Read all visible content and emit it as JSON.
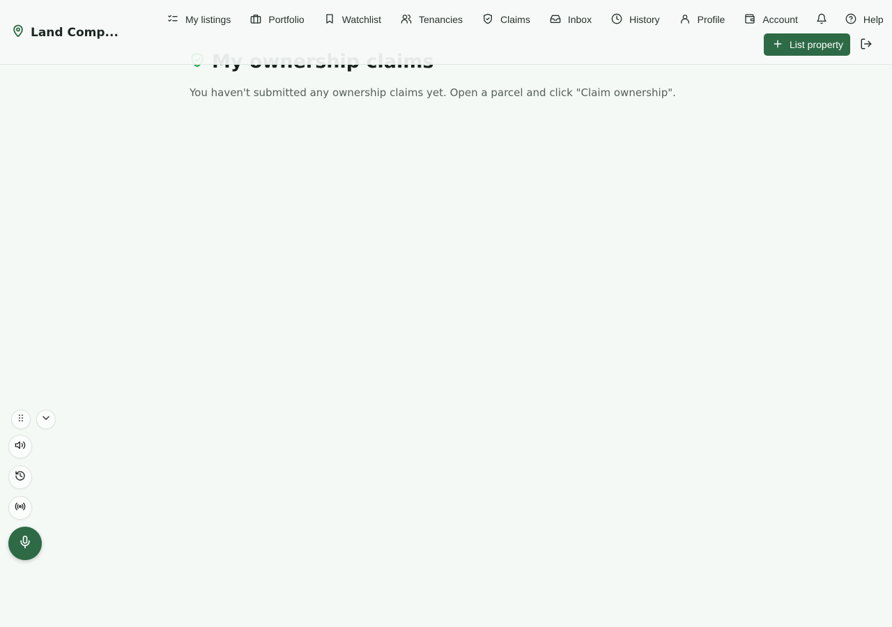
{
  "brand": {
    "name": "Land Comp...",
    "icon": "map-pin-icon"
  },
  "nav": [
    {
      "label": "My listings",
      "icon": "list-checks-icon"
    },
    {
      "label": "Portfolio",
      "icon": "briefcase-icon"
    },
    {
      "label": "Watchlist",
      "icon": "bookmark-icon"
    },
    {
      "label": "Tenancies",
      "icon": "users-icon"
    },
    {
      "label": "Claims",
      "icon": "shield-check-icon"
    },
    {
      "label": "Inbox",
      "icon": "inbox-icon"
    },
    {
      "label": "History",
      "icon": "clock-icon"
    },
    {
      "label": "Profile",
      "icon": "user-icon"
    },
    {
      "label": "Account",
      "icon": "wallet-icon"
    },
    {
      "label": "",
      "icon": "bell-icon"
    },
    {
      "label": "Help",
      "icon": "help-circle-icon"
    }
  ],
  "actions": {
    "list_property": "List property",
    "logout_icon": "log-out-icon"
  },
  "main": {
    "title": "My ownership claims",
    "title_icon": "shield-check-icon",
    "empty_message": "You haven't submitted any ownership claims yet. Open a parcel and click \"Claim ownership\"."
  },
  "voice_tools": {
    "icons": [
      "grip-icon",
      "chevron-down-icon",
      "speaker-icon",
      "history-icon",
      "broadcast-icon",
      "microphone-icon"
    ]
  },
  "colors": {
    "accent": "#2d6a45",
    "background": "#f5f9f6",
    "title_icon": "#16a34a"
  }
}
